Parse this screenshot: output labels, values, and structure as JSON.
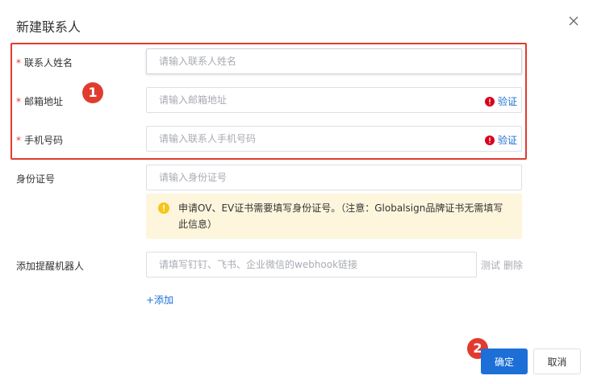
{
  "dialog": {
    "title": "新建联系人"
  },
  "form": {
    "required_mark": "*",
    "name": {
      "label": "联系人姓名",
      "placeholder": "请输入联系人姓名"
    },
    "email": {
      "label": "邮箱地址",
      "placeholder": "请输入邮箱地址",
      "verify_label": "验证"
    },
    "phone": {
      "label": "手机号码",
      "placeholder": "请输入联系人手机号码",
      "verify_label": "验证"
    },
    "id_number": {
      "label": "身份证号",
      "placeholder": "请输入身份证号"
    },
    "id_notice": "申请OV、EV证书需要填写身份证号。（注意：Globalsign品牌证书无需填写此信息）",
    "robot": {
      "label": "添加提醒机器人",
      "placeholder": "请填写钉钉、飞书、企业微信的webhook链接",
      "test_label": "测试",
      "delete_label": "删除"
    },
    "add_label": "+添加"
  },
  "footer": {
    "confirm_label": "确定",
    "cancel_label": "取消"
  },
  "annotations": {
    "badge_1": "1",
    "badge_2": "2"
  },
  "colors": {
    "primary": "#1c6fd6",
    "highlight": "#e13b30",
    "error": "#d9001b",
    "warning": "#f5c518",
    "notice_bg": "#fdf6dc"
  }
}
